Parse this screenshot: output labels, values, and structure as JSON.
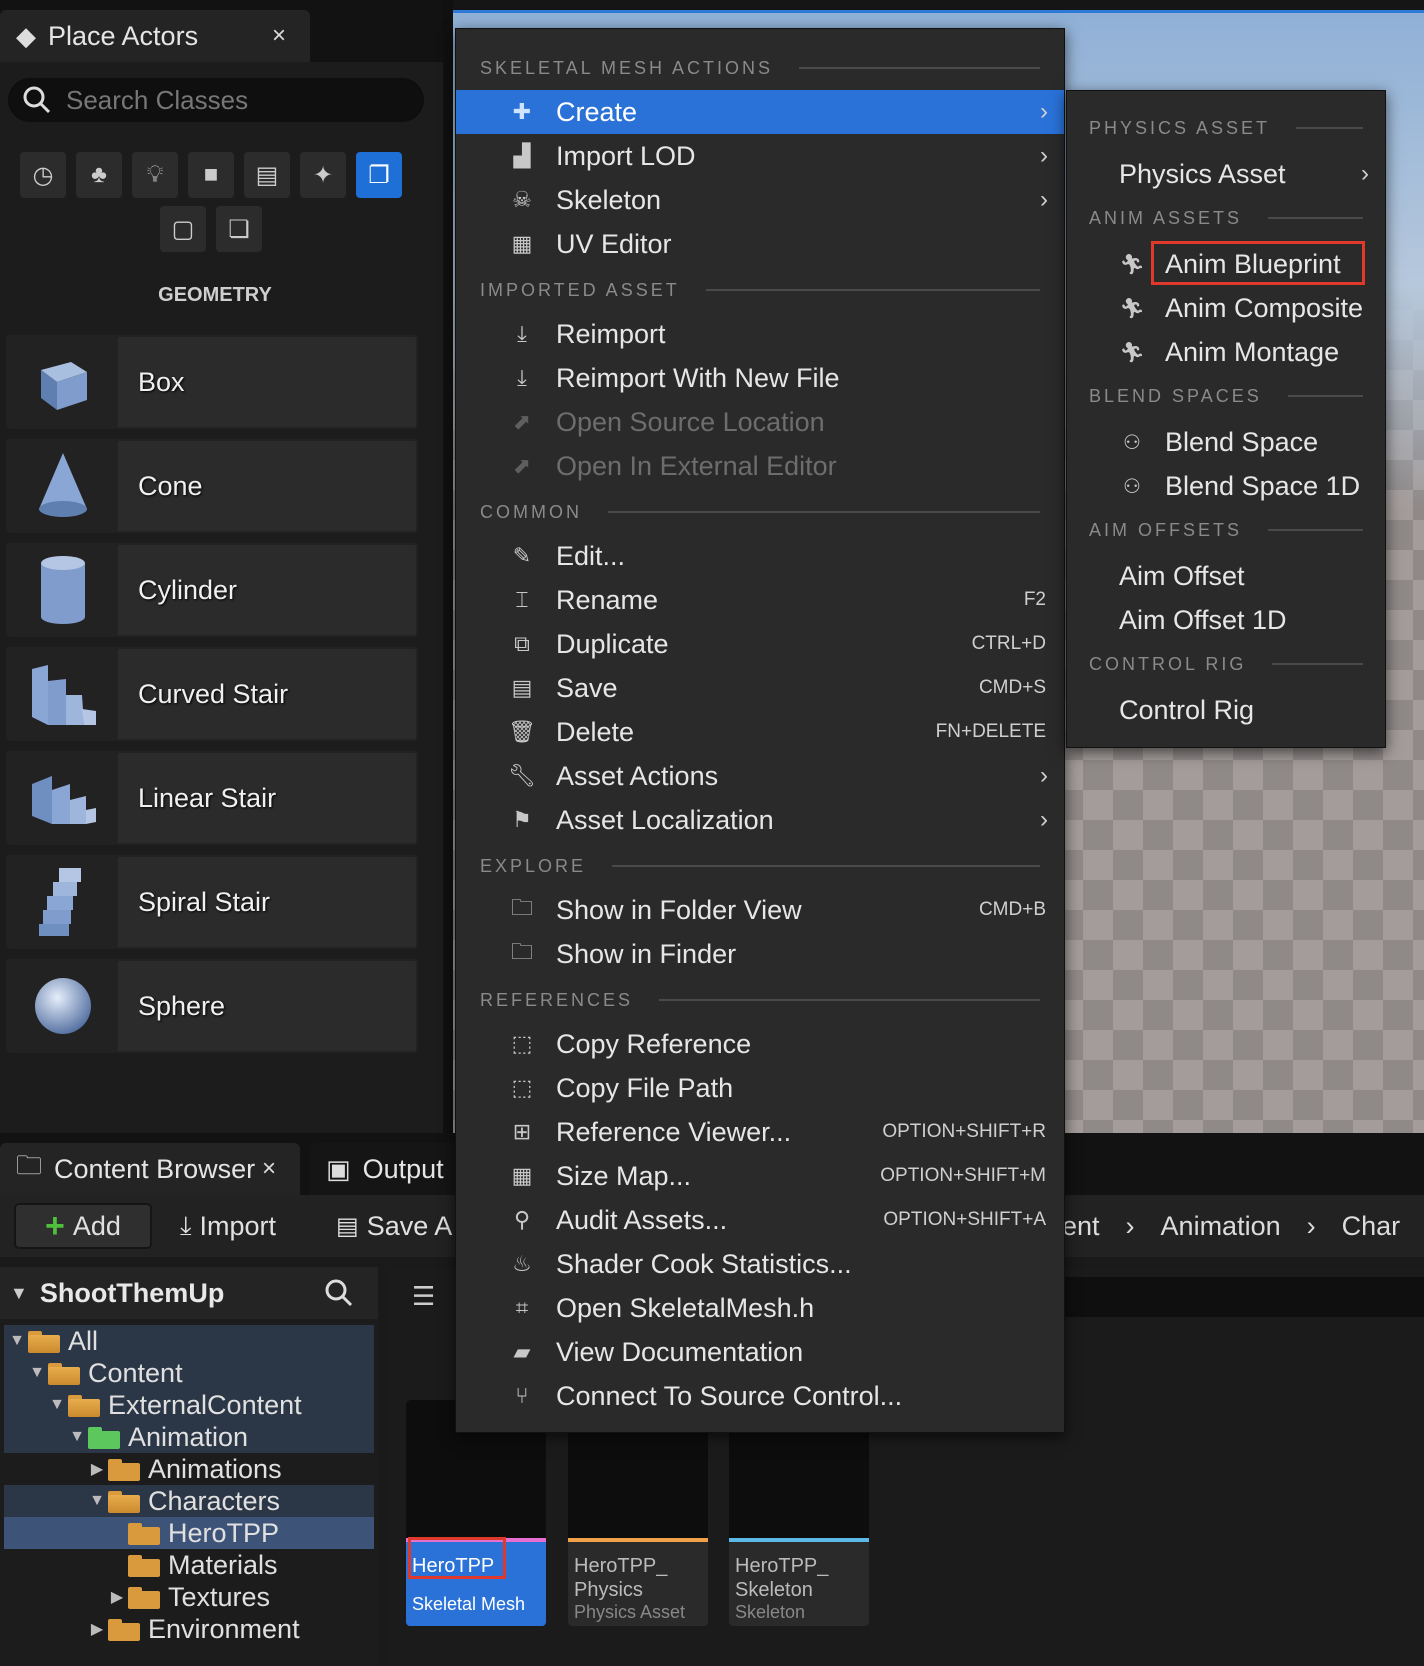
{
  "place_actors": {
    "tab_title": "Place Actors",
    "close_glyph": "×",
    "search_placeholder": "Search Classes",
    "category_label": "GEOMETRY",
    "categories": [
      "recent-icon",
      "basic-icon",
      "lights-icon",
      "shapes-icon",
      "cinematic-icon",
      "visual-effects-icon",
      "geometry-icon",
      "volumes-icon",
      "all-classes-icon"
    ],
    "items": [
      {
        "label": "Box",
        "icon": "box-icon"
      },
      {
        "label": "Cone",
        "icon": "cone-icon"
      },
      {
        "label": "Cylinder",
        "icon": "cylinder-icon"
      },
      {
        "label": "Curved Stair",
        "icon": "curved-stair-icon"
      },
      {
        "label": "Linear Stair",
        "icon": "linear-stair-icon"
      },
      {
        "label": "Spiral Stair",
        "icon": "spiral-stair-icon"
      },
      {
        "label": "Sphere",
        "icon": "sphere-icon"
      }
    ]
  },
  "content_browser": {
    "tab_title": "Content Browser",
    "close_glyph": "×",
    "output_tab": "Output",
    "add_label": "Add",
    "import_label": "Import",
    "save_label": "Save A",
    "breadcrumb": [
      "ent",
      "Animation",
      "Char"
    ],
    "sources_title": "ShootThemUp",
    "tree": [
      {
        "label": "All",
        "expanded": true
      },
      {
        "label": "Content",
        "expanded": true
      },
      {
        "label": "ExternalContent",
        "expanded": true
      },
      {
        "label": "Animation",
        "expanded": true
      },
      {
        "label": "Animations",
        "expanded": false
      },
      {
        "label": "Characters",
        "expanded": true
      },
      {
        "label": "HeroTPP",
        "expanded": false
      },
      {
        "label": "Materials",
        "expanded": false
      },
      {
        "label": "Textures",
        "expanded": false
      },
      {
        "label": "Environment",
        "expanded": false
      }
    ],
    "assets": [
      {
        "name": "HeroTPP",
        "type": "Skeletal Mesh",
        "bar_color": "#e46fd0"
      },
      {
        "name": "HeroTPP_ Physics",
        "type": "Physics Asset",
        "bar_color": "#f0a14a"
      },
      {
        "name": "HeroTPP_ Skeleton",
        "type": "Skeleton",
        "bar_color": "#5cb8e6"
      }
    ]
  },
  "context_menu": {
    "sections": {
      "skeletal": "SKELETAL MESH ACTIONS",
      "imported": "IMPORTED ASSET",
      "common": "COMMON",
      "explore": "EXPLORE",
      "references": "REFERENCES"
    },
    "items": {
      "create": {
        "label": "Create",
        "icon": "create-icon",
        "arrow": "›"
      },
      "import_lod": {
        "label": "Import LOD",
        "icon": "import-lod-icon",
        "arrow": "›"
      },
      "skeleton": {
        "label": "Skeleton",
        "icon": "skeleton-icon",
        "arrow": "›"
      },
      "uv_editor": {
        "label": "UV Editor",
        "icon": "uv-editor-icon"
      },
      "reimport": {
        "label": "Reimport",
        "icon": "reimport-icon"
      },
      "reimport_new": {
        "label": "Reimport With New File",
        "icon": "reimport-icon"
      },
      "open_source": {
        "label": "Open Source Location",
        "icon": "open-source-icon"
      },
      "open_external": {
        "label": "Open In External Editor",
        "icon": "external-editor-icon"
      },
      "edit": {
        "label": "Edit...",
        "icon": "edit-icon"
      },
      "rename": {
        "label": "Rename",
        "icon": "rename-icon",
        "shortcut": "F2"
      },
      "duplicate": {
        "label": "Duplicate",
        "icon": "duplicate-icon",
        "shortcut": "CTRL+D"
      },
      "save": {
        "label": "Save",
        "icon": "save-icon",
        "shortcut": "CMD+S"
      },
      "delete": {
        "label": "Delete",
        "icon": "delete-icon",
        "shortcut": "FN+DELETE"
      },
      "asset_actions": {
        "label": "Asset Actions",
        "icon": "wrench-icon",
        "arrow": "›"
      },
      "asset_localization": {
        "label": "Asset Localization",
        "icon": "flag-icon",
        "arrow": "›"
      },
      "show_folder": {
        "label": "Show in Folder View",
        "icon": "folder-search-icon",
        "shortcut": "CMD+B"
      },
      "show_finder": {
        "label": "Show in Finder",
        "icon": "folder-search-icon"
      },
      "copy_ref": {
        "label": "Copy Reference",
        "icon": "copy-icon"
      },
      "copy_path": {
        "label": "Copy File Path",
        "icon": "copy-icon"
      },
      "ref_viewer": {
        "label": "Reference Viewer...",
        "icon": "reference-viewer-icon",
        "shortcut": "OPTION+SHIFT+R"
      },
      "size_map": {
        "label": "Size Map...",
        "icon": "size-map-icon",
        "shortcut": "OPTION+SHIFT+M"
      },
      "audit": {
        "label": "Audit Assets...",
        "icon": "audit-icon",
        "shortcut": "OPTION+SHIFT+A"
      },
      "shader_cook": {
        "label": "Shader Cook Statistics...",
        "icon": "shader-icon"
      },
      "open_h": {
        "label": "Open SkeletalMesh.h",
        "icon": "cpp-icon"
      },
      "view_docs": {
        "label": "View Documentation",
        "icon": "docs-icon"
      },
      "connect_sc": {
        "label": "Connect To Source Control...",
        "icon": "source-control-icon"
      }
    }
  },
  "submenu": {
    "sections": {
      "physics": "PHYSICS ASSET",
      "anim": "ANIM ASSETS",
      "blend": "BLEND SPACES",
      "aim": "AIM OFFSETS",
      "control": "CONTROL RIG"
    },
    "items": {
      "physics_asset": {
        "label": "Physics Asset",
        "arrow": "›"
      },
      "anim_blueprint": {
        "label": "Anim Blueprint",
        "icon": "anim-blueprint-icon"
      },
      "anim_composite": {
        "label": "Anim Composite",
        "icon": "anim-composite-icon"
      },
      "anim_montage": {
        "label": "Anim Montage",
        "icon": "anim-montage-icon"
      },
      "blend_space": {
        "label": "Blend Space",
        "icon": "blend-space-icon"
      },
      "blend_space_1d": {
        "label": "Blend Space 1D",
        "icon": "blend-space-icon"
      },
      "aim_offset": {
        "label": "Aim Offset"
      },
      "aim_offset_1d": {
        "label": "Aim Offset 1D"
      },
      "control_rig": {
        "label": "Control Rig"
      }
    }
  },
  "colors": {
    "accent": "#2a72d8",
    "highlight_box": "#e0392b",
    "add_green": "#4fbf3d"
  }
}
